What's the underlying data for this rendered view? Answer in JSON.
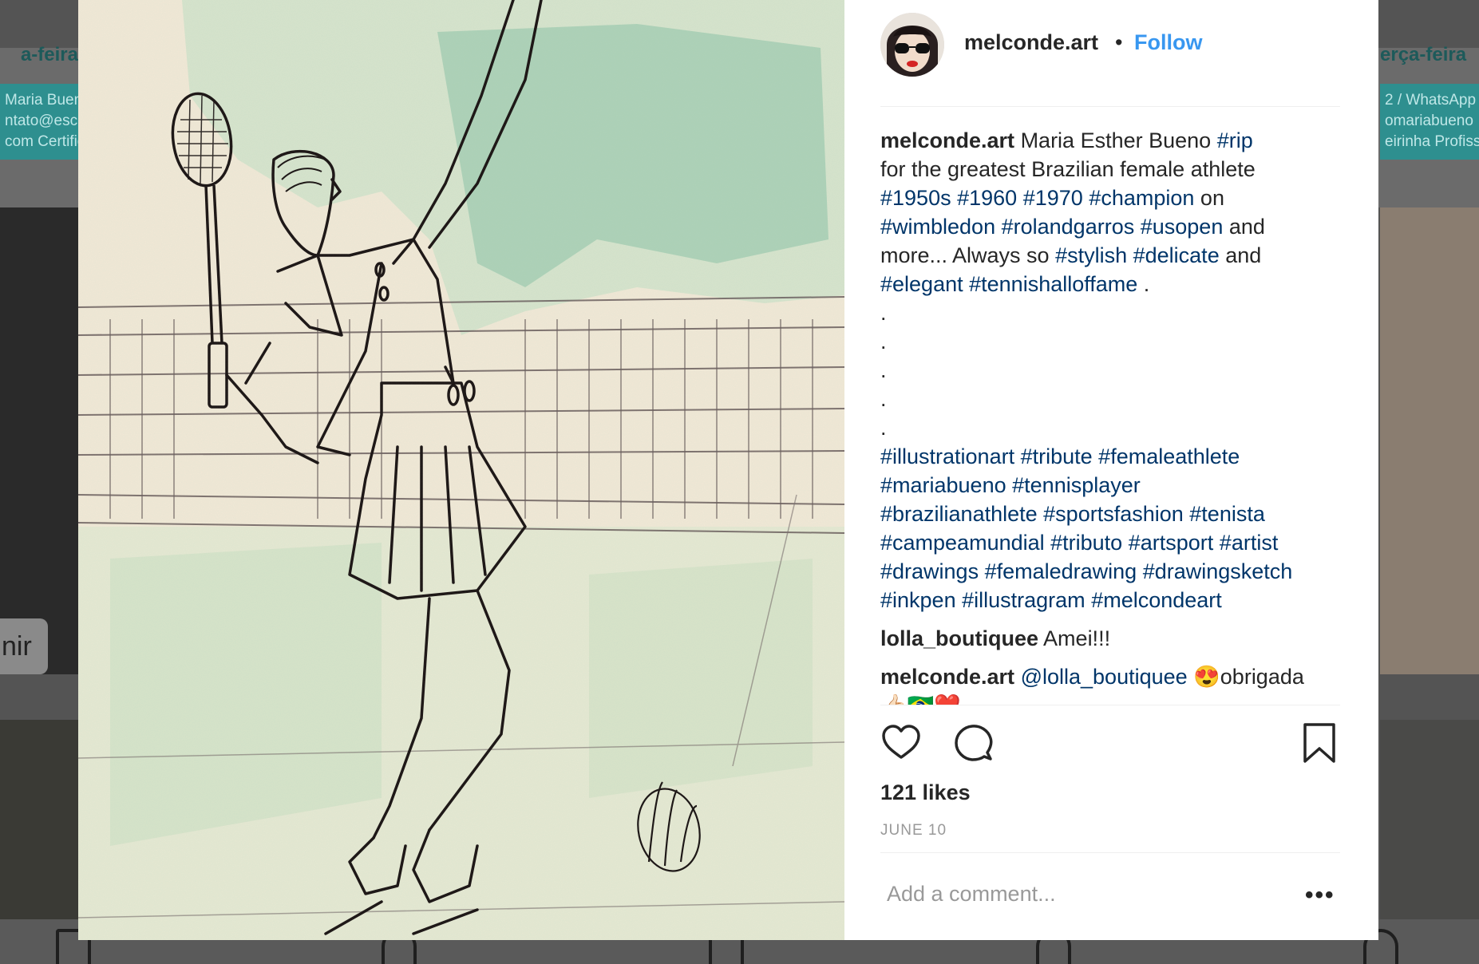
{
  "background": {
    "left_day": "a-feira",
    "right_day": "erça-feira",
    "left_banner_lines": [
      "Maria Buene",
      "ntato@esco",
      "com Certific"
    ],
    "right_banner_lines": [
      "2 / WhatsApp",
      "omariabueno",
      "eirinha Profiss"
    ],
    "left_pill_text": "nir"
  },
  "post": {
    "username": "melconde.art",
    "separator": "•",
    "follow_label": "Follow",
    "caption_username": "melconde.art",
    "caption_lines": [
      [
        {
          "t": "Maria Esther Bueno "
        },
        {
          "t": "#rip",
          "tag": true
        }
      ],
      [
        {
          "t": "for the greatest Brazilian female athlete"
        }
      ],
      [
        {
          "t": "#1950s",
          "tag": true
        },
        {
          "t": " "
        },
        {
          "t": "#1960",
          "tag": true
        },
        {
          "t": " "
        },
        {
          "t": "#1970",
          "tag": true
        },
        {
          "t": " "
        },
        {
          "t": "#champion",
          "tag": true
        },
        {
          "t": " on"
        }
      ],
      [
        {
          "t": "#wimbledon",
          "tag": true
        },
        {
          "t": " "
        },
        {
          "t": "#rolandgarros",
          "tag": true
        },
        {
          "t": " "
        },
        {
          "t": "#usopen",
          "tag": true
        },
        {
          "t": " and"
        }
      ],
      [
        {
          "t": "more... Always so "
        },
        {
          "t": "#stylish",
          "tag": true
        },
        {
          "t": " "
        },
        {
          "t": "#delicate",
          "tag": true
        },
        {
          "t": " and"
        }
      ],
      [
        {
          "t": "#elegant",
          "tag": true
        },
        {
          "t": " "
        },
        {
          "t": "#tennishalloffame",
          "tag": true
        },
        {
          "t": " ."
        }
      ]
    ],
    "dot_lines": [
      ".",
      ".",
      ".",
      ".",
      "."
    ],
    "hashtag_lines": [
      "#illustrationart #tribute #femaleathlete",
      "#mariabueno #tennisplayer",
      "#brazilianathlete #sportsfashion #tenista",
      "#campeamundial #tributo #artsport #artist",
      "#drawings #femaledrawing #drawingsketch",
      "#inkpen #illustragram #melcondeart"
    ],
    "comments": [
      {
        "user": "lolla_boutiquee",
        "text": "Amei!!!"
      },
      {
        "user": "melconde.art",
        "mention": "@lolla_boutiquee",
        "text": "😍obrigada",
        "text2": "👍🏻🇧🇷❤️"
      }
    ],
    "likes": "121 likes",
    "date": "JUNE 10",
    "add_comment_placeholder": "Add a comment...",
    "more_label": "•••",
    "colors": {
      "link": "#3897f0",
      "hashtag": "#003569",
      "text": "#262626",
      "muted": "#999999"
    }
  }
}
